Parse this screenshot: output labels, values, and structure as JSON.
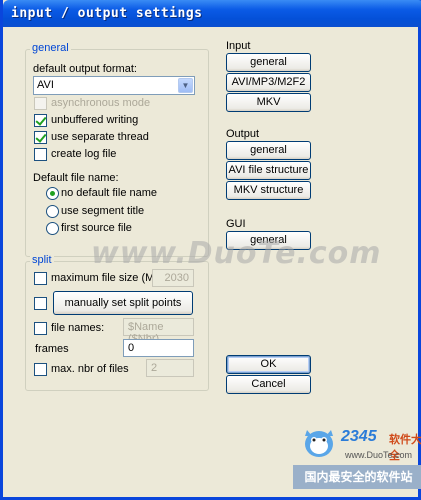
{
  "window": {
    "title": "input / output settings"
  },
  "general_group": {
    "legend": "general",
    "format_label": "default output format:",
    "format_value": "AVI",
    "async_label": "asynchronous mode",
    "async_checked": false,
    "unbuffered_label": "unbuffered writing",
    "unbuffered_checked": true,
    "separate_thread_label": "use separate thread",
    "separate_thread_checked": true,
    "create_log_label": "create log file",
    "create_log_checked": false,
    "default_name_label": "Default file name:",
    "radio_no_default": "no default file name",
    "radio_segment": "use segment title",
    "radio_first_source": "first source file",
    "selected_radio": "no default file name"
  },
  "split_group": {
    "legend": "split",
    "max_size_label": "maximum file size (MB)",
    "max_size_value": "2030",
    "manual_button": "manually set split points",
    "file_names_label": "file names:",
    "file_names_value": "$Name ($Nbr)",
    "frames_label": "frames",
    "frames_value": "0",
    "max_files_label": "max. nbr of files",
    "max_files_value": "2"
  },
  "input_section": {
    "label": "Input",
    "buttons": [
      "general",
      "AVI/MP3/M2F2",
      "MKV"
    ]
  },
  "output_section": {
    "label": "Output",
    "buttons": [
      "general",
      "AVI file structure",
      "MKV structure"
    ]
  },
  "gui_section": {
    "label": "GUI",
    "button": "general"
  },
  "dialog": {
    "ok": "OK",
    "cancel": "Cancel"
  },
  "watermark": {
    "text": "www.DuoTe.com"
  },
  "logo": {
    "number": "2345",
    "name": "软件大全",
    "url": "www.DuoTe.com",
    "slogan": "国内最安全的软件站"
  },
  "colors": {
    "titlebar": "#0450d8",
    "group_legend": "#0046d5",
    "check": "#21a121"
  }
}
